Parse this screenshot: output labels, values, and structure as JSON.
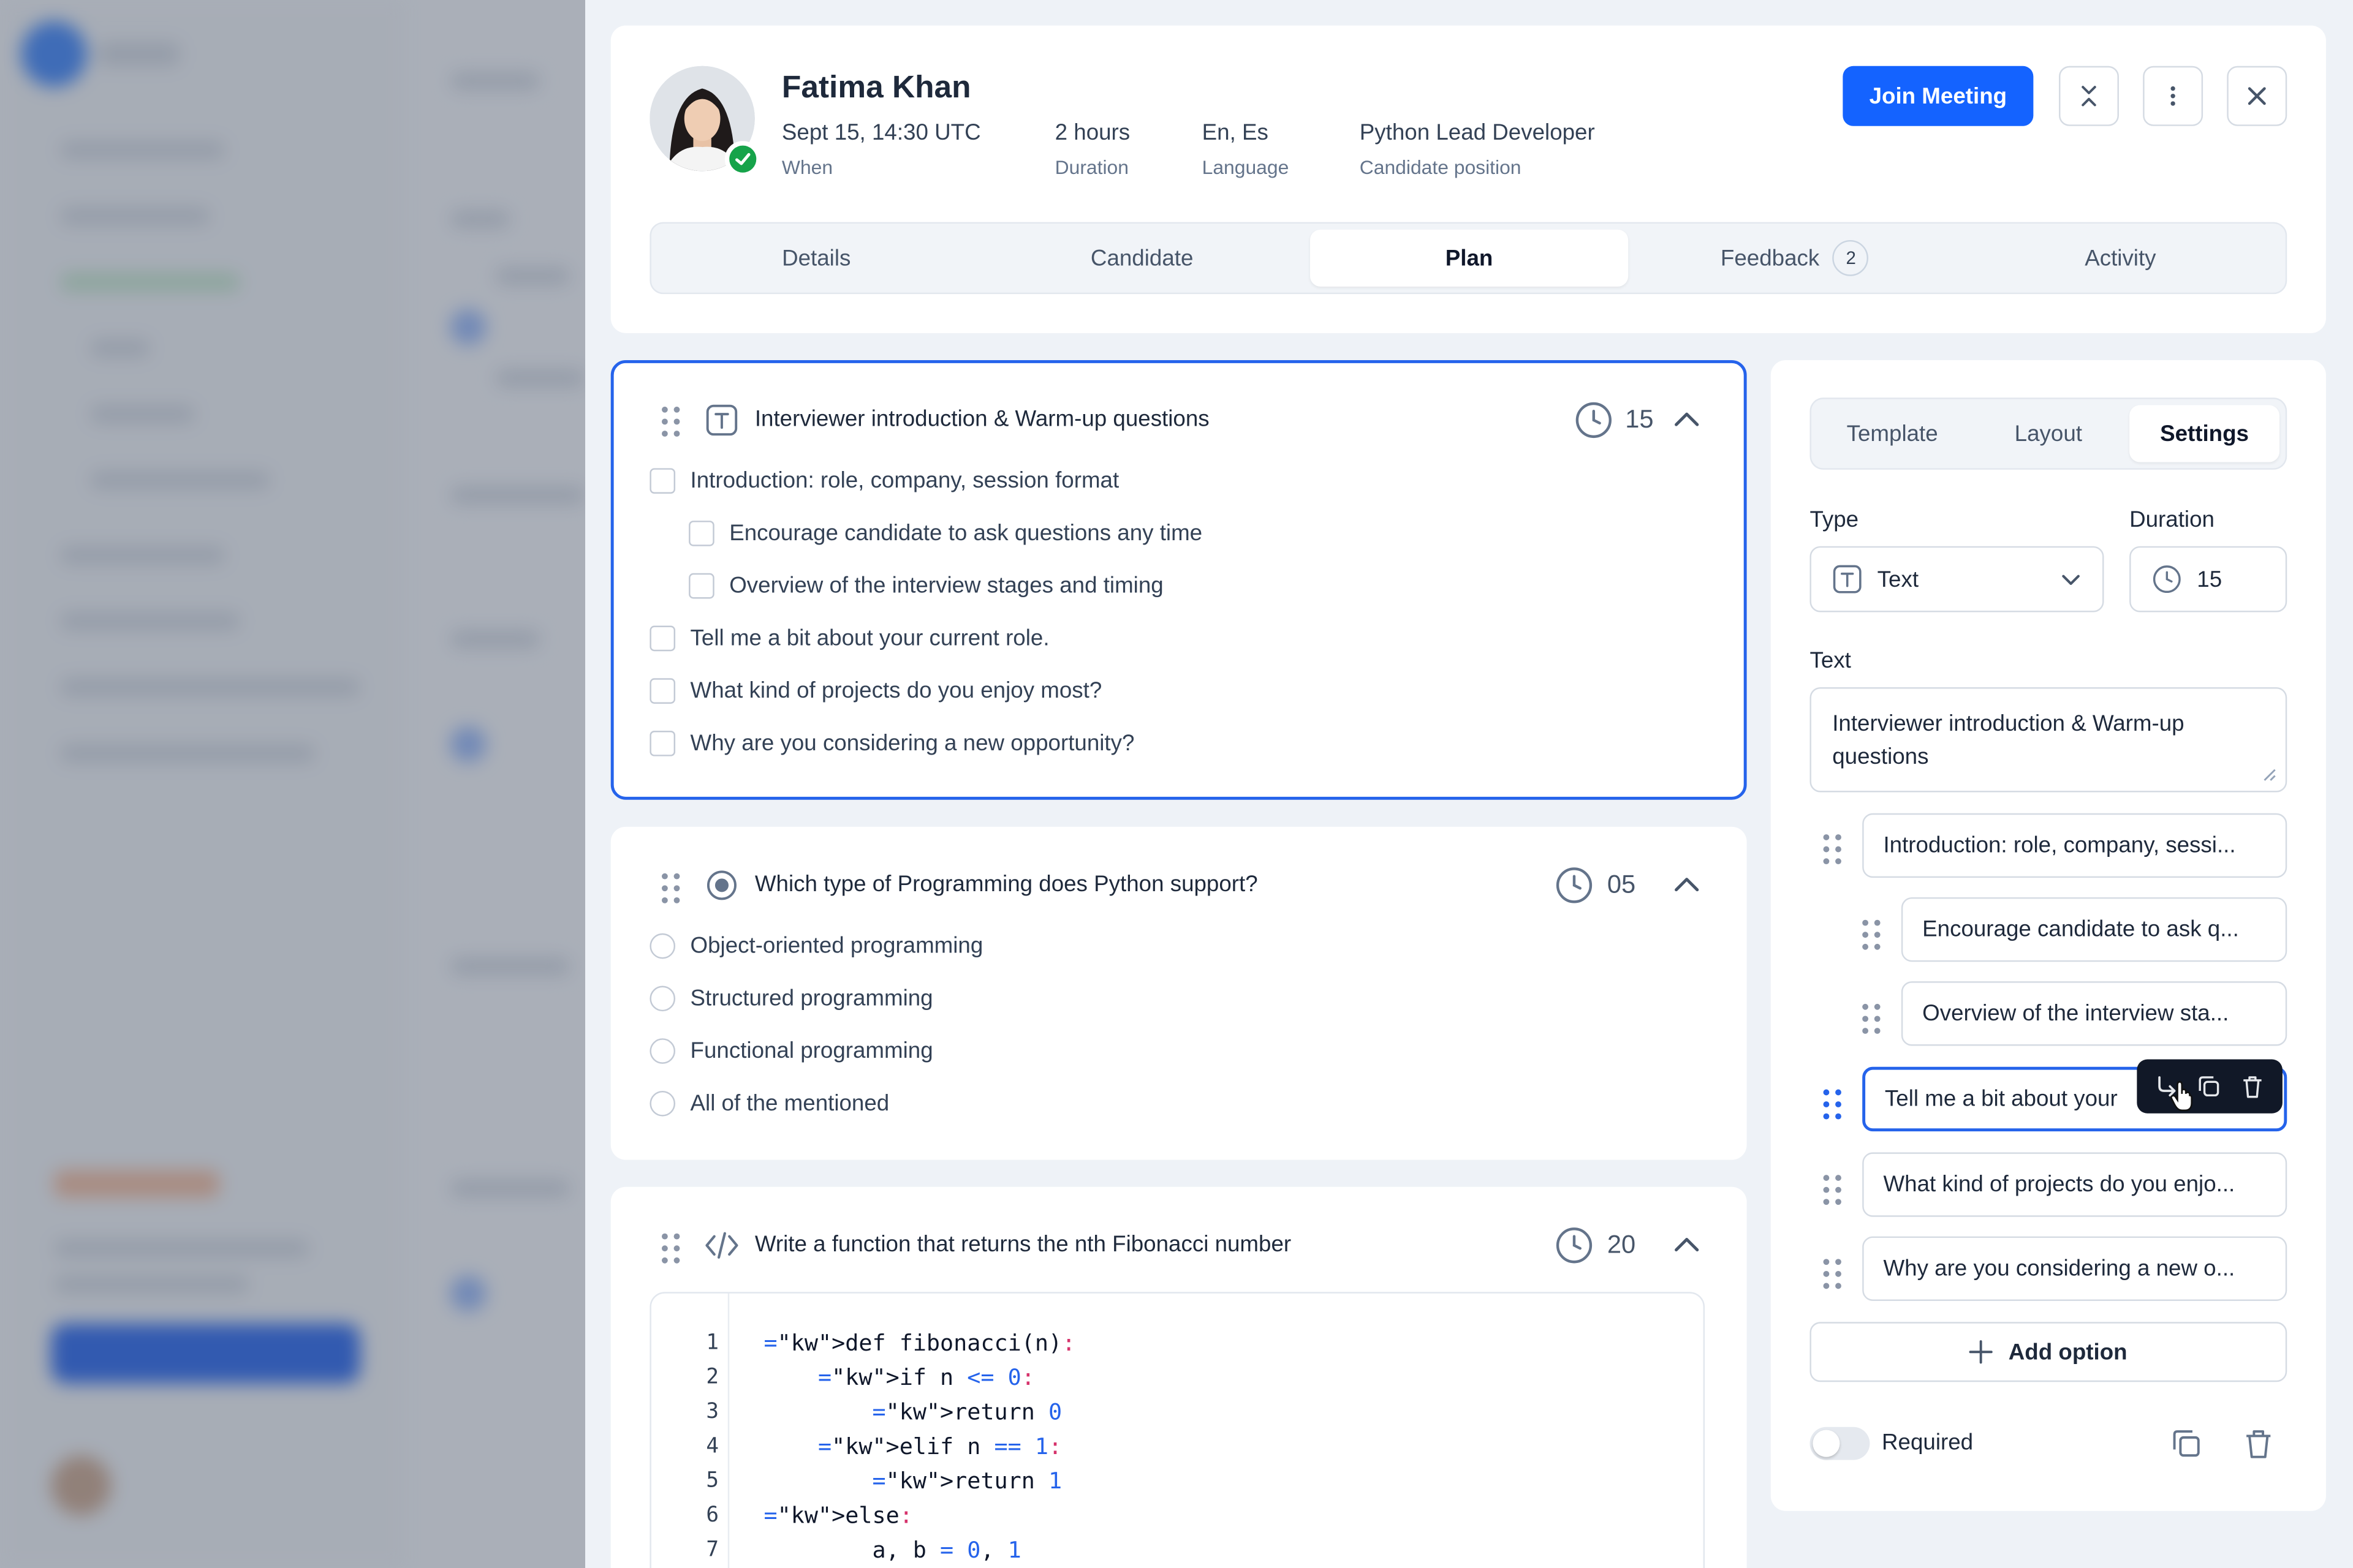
{
  "header": {
    "name": "Fatima Khan",
    "meta": [
      {
        "value": "Sept 15, 14:30 UTC",
        "label": "When"
      },
      {
        "value": "2 hours",
        "label": "Duration"
      },
      {
        "value": "En, Es",
        "label": "Language"
      },
      {
        "value": "Python Lead Developer",
        "label": "Candidate position"
      }
    ],
    "join_label": "Join Meeting",
    "tabs": [
      {
        "label": "Details"
      },
      {
        "label": "Candidate"
      },
      {
        "label": "Plan"
      },
      {
        "label": "Feedback",
        "count": "2"
      },
      {
        "label": "Activity"
      }
    ],
    "active_tab": "Plan"
  },
  "questions": [
    {
      "type": "text",
      "title": "Interviewer introduction & Warm-up questions",
      "duration": "15",
      "items": [
        "Introduction: role, company, session format",
        "Encourage candidate to ask questions any time",
        "Overview of the interview stages and timing",
        "Tell me a bit about your current role.",
        "What kind of projects do you enjoy most?",
        "Why are you considering a new opportunity?"
      ]
    },
    {
      "type": "single-choice",
      "title": "Which type of Programming does Python support?",
      "duration": "05",
      "items": [
        "Object-oriented programming",
        "Structured programming",
        "Functional programming",
        "All of the mentioned"
      ]
    },
    {
      "type": "code",
      "title": "Write a function that returns the nth Fibonacci number",
      "duration": "20",
      "code_lines": [
        {
          "n": "1",
          "text": "def fibonacci(n):"
        },
        {
          "n": "2",
          "text": "    if n <= 0:"
        },
        {
          "n": "3",
          "text": "        return 0"
        },
        {
          "n": "4",
          "text": "    elif n == 1:"
        },
        {
          "n": "5",
          "text": "        return 1"
        },
        {
          "n": "6",
          "text": "else:"
        },
        {
          "n": "7",
          "text": "        a, b = 0, 1"
        }
      ]
    }
  ],
  "settings": {
    "tabs": [
      "Template",
      "Layout",
      "Settings"
    ],
    "active_tab": "Settings",
    "type_label": "Type",
    "type_value": "Text",
    "duration_label": "Duration",
    "duration_value": "15",
    "text_label": "Text",
    "text_value": "Interviewer introduction & Warm-up questions",
    "options": [
      "Introduction: role, company, sessi...",
      "Encourage candidate to ask q...",
      "Overview of the interview sta...",
      "Tell me a bit about your",
      "What kind of projects do you enjo...",
      "Why are you considering a new o..."
    ],
    "add_option_label": "Add option",
    "required_label": "Required"
  },
  "colors": {
    "accent": "#1463ff",
    "focus": "#2563eb",
    "success": "#16a34a"
  }
}
